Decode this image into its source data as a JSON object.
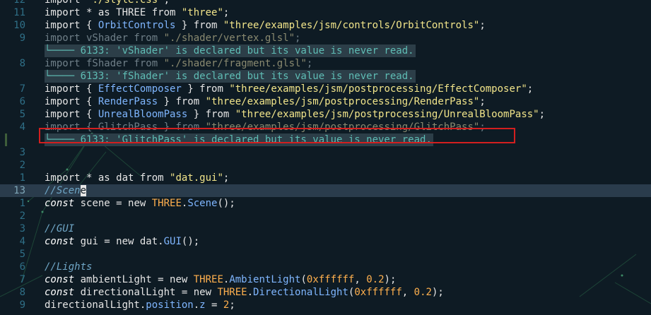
{
  "editor": {
    "lines": [
      {
        "num": "12",
        "tokens": [
          {
            "t": "import ",
            "c": "kw"
          },
          {
            "t": "\"./style.css\"",
            "c": "st"
          },
          {
            "t": ";",
            "c": "kw"
          }
        ]
      },
      {
        "num": "11",
        "tokens": [
          {
            "t": "import * as THREE from ",
            "c": "kw"
          },
          {
            "t": "\"three\"",
            "c": "st"
          },
          {
            "t": ";",
            "c": "kw"
          }
        ]
      },
      {
        "num": "10",
        "tokens": [
          {
            "t": "import { ",
            "c": "kw"
          },
          {
            "t": "OrbitControls",
            "c": "cl"
          },
          {
            "t": " } from ",
            "c": "kw"
          },
          {
            "t": "\"three/examples/jsm/controls/OrbitControls\"",
            "c": "st"
          },
          {
            "t": ";",
            "c": "kw"
          }
        ]
      },
      {
        "num": "9",
        "dim": true,
        "tokens": [
          {
            "t": "import vShader from ",
            "c": ""
          },
          {
            "t": "\"./shader/vertex.glsl\"",
            "c": "st"
          },
          {
            "t": ";",
            "c": ""
          }
        ]
      },
      {
        "num": "",
        "diag": "└──── 6133: 'vShader' is declared but its value is never read."
      },
      {
        "num": "8",
        "dim": true,
        "tokens": [
          {
            "t": "import fShader from ",
            "c": ""
          },
          {
            "t": "\"./shader/fragment.glsl\"",
            "c": "st"
          },
          {
            "t": ";",
            "c": ""
          }
        ]
      },
      {
        "num": "",
        "diag": "└──── 6133: 'fShader' is declared but its value is never read."
      },
      {
        "num": "7",
        "tokens": [
          {
            "t": "import { ",
            "c": "kw"
          },
          {
            "t": "EffectComposer",
            "c": "cl"
          },
          {
            "t": " } from ",
            "c": "kw"
          },
          {
            "t": "\"three/examples/jsm/postprocessing/EffectComposer\"",
            "c": "st"
          },
          {
            "t": ";",
            "c": "kw"
          }
        ]
      },
      {
        "num": "6",
        "tokens": [
          {
            "t": "import { ",
            "c": "kw"
          },
          {
            "t": "RenderPass",
            "c": "cl"
          },
          {
            "t": " } from ",
            "c": "kw"
          },
          {
            "t": "\"three/examples/jsm/postprocessing/RenderPass\"",
            "c": "st"
          },
          {
            "t": ";",
            "c": "kw"
          }
        ]
      },
      {
        "num": "5",
        "tokens": [
          {
            "t": "import { ",
            "c": "kw"
          },
          {
            "t": "UnrealBloomPass",
            "c": "cl"
          },
          {
            "t": " } from ",
            "c": "kw"
          },
          {
            "t": "\"three/examples/jsm/postprocessing/UnrealBloomPass\"",
            "c": "st"
          },
          {
            "t": ";",
            "c": "kw"
          }
        ]
      },
      {
        "num": "4",
        "dim": true,
        "tokens": [
          {
            "t": "import { GlitchPass } from ",
            "c": ""
          },
          {
            "t": "\"three/examples/jsm/postprocessing/GlitchPass\"",
            "c": "st"
          },
          {
            "t": ";",
            "c": ""
          }
        ]
      },
      {
        "num": "",
        "sign": true,
        "diag": "└──── 6133: 'GlitchPass' is declared but its value is never read."
      },
      {
        "num": "3",
        "tokens": []
      },
      {
        "num": "2",
        "tokens": []
      },
      {
        "num": "1",
        "tokens": [
          {
            "t": "import * as dat from ",
            "c": "kw"
          },
          {
            "t": "\"dat.gui\"",
            "c": "st"
          },
          {
            "t": ";",
            "c": "kw"
          }
        ]
      },
      {
        "num": "13",
        "current": true,
        "tokens": [
          {
            "t": "//Scen",
            "c": "cm"
          },
          {
            "t": "e",
            "c": "cursor"
          }
        ]
      },
      {
        "num": "1",
        "tokens": [
          {
            "t": "const",
            "c": "it"
          },
          {
            "t": " scene = new ",
            "c": "kw"
          },
          {
            "t": "THREE",
            "c": "th"
          },
          {
            "t": ".",
            "c": "kw"
          },
          {
            "t": "Scene",
            "c": "cl"
          },
          {
            "t": "();",
            "c": "kw"
          }
        ]
      },
      {
        "num": "2",
        "tokens": []
      },
      {
        "num": "3",
        "tokens": [
          {
            "t": "//GUI",
            "c": "cm"
          }
        ]
      },
      {
        "num": "4",
        "tokens": [
          {
            "t": "const",
            "c": "it"
          },
          {
            "t": " gui = new dat.",
            "c": "kw"
          },
          {
            "t": "GUI",
            "c": "cl"
          },
          {
            "t": "();",
            "c": "kw"
          }
        ]
      },
      {
        "num": "5",
        "tokens": []
      },
      {
        "num": "6",
        "tokens": [
          {
            "t": "//Lights",
            "c": "cm"
          }
        ]
      },
      {
        "num": "7",
        "tokens": [
          {
            "t": "const",
            "c": "it"
          },
          {
            "t": " ambientLight = new ",
            "c": "kw"
          },
          {
            "t": "THREE",
            "c": "th"
          },
          {
            "t": ".",
            "c": "kw"
          },
          {
            "t": "AmbientLight",
            "c": "cl"
          },
          {
            "t": "(",
            "c": "kw"
          },
          {
            "t": "0xffffff",
            "c": "nm"
          },
          {
            "t": ", ",
            "c": "kw"
          },
          {
            "t": "0.2",
            "c": "nm"
          },
          {
            "t": ");",
            "c": "kw"
          }
        ]
      },
      {
        "num": "8",
        "tokens": [
          {
            "t": "const",
            "c": "it"
          },
          {
            "t": " directionalLight = new ",
            "c": "kw"
          },
          {
            "t": "THREE",
            "c": "th"
          },
          {
            "t": ".",
            "c": "kw"
          },
          {
            "t": "DirectionalLight",
            "c": "cl"
          },
          {
            "t": "(",
            "c": "kw"
          },
          {
            "t": "0xffffff",
            "c": "nm"
          },
          {
            "t": ", ",
            "c": "kw"
          },
          {
            "t": "0.2",
            "c": "nm"
          },
          {
            "t": ");",
            "c": "kw"
          }
        ]
      },
      {
        "num": "9",
        "tokens": [
          {
            "t": "directionalLight.",
            "c": "kw"
          },
          {
            "t": "position",
            "c": "cl"
          },
          {
            "t": ".",
            "c": "kw"
          },
          {
            "t": "z",
            "c": "cl"
          },
          {
            "t": " = ",
            "c": "kw"
          },
          {
            "t": "2",
            "c": "nm"
          },
          {
            "t": ";",
            "c": "kw"
          }
        ]
      }
    ]
  },
  "colors": {
    "background": "#0e1b24",
    "diagnostic": "#5fbdb5",
    "highlight_box": "#d21f1f"
  }
}
